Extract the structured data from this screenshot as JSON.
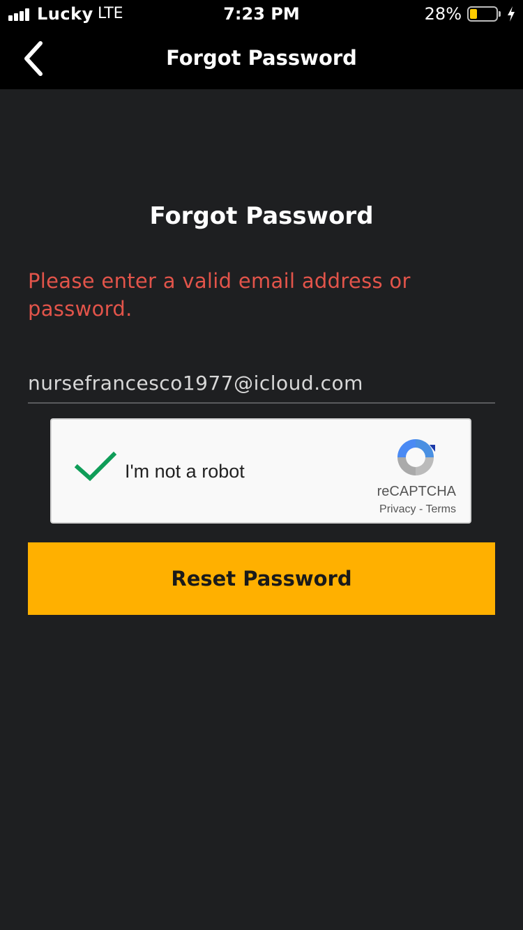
{
  "status_bar": {
    "carrier": "Lucky",
    "network": "LTE",
    "time": "7:23 PM",
    "battery_percent": "28%",
    "battery_level": 0.28,
    "battery_color": "#ffcc00",
    "charging": true,
    "signal_icon": "signal-bars-icon"
  },
  "nav": {
    "back_icon": "chevron-left-icon",
    "title": "Forgot Password"
  },
  "main": {
    "title": "Forgot Password",
    "error_message": "Please enter a valid email address or password.",
    "error_color": "#e2544a",
    "email_value": "nursefrancesco1977@icloud.com"
  },
  "recaptcha": {
    "checked": true,
    "label": "I'm not a robot",
    "brand": "reCAPTCHA",
    "privacy_label": "Privacy",
    "separator": " - ",
    "terms_label": "Terms",
    "check_color": "#0f9d58"
  },
  "actions": {
    "reset_label": "Reset Password",
    "accent_color": "#ffb000"
  }
}
